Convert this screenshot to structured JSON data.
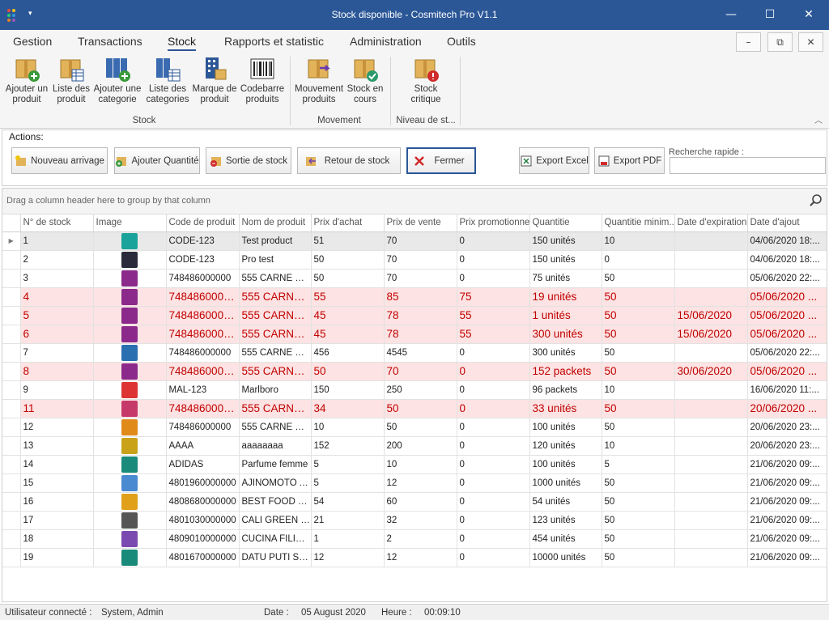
{
  "window": {
    "title": "Stock disponible - Cosmitech Pro V1.1",
    "qa_glyph": "▾",
    "minimize": "—",
    "maximize": "☐",
    "close": "✕"
  },
  "menu": {
    "items": [
      "Gestion",
      "Transactions",
      "Stock",
      "Rapports et statistic",
      "Administration",
      "Outils"
    ],
    "active": "Stock"
  },
  "mdi": {
    "minimize": "–",
    "restore": "⧉",
    "close": "✕"
  },
  "ribbon": {
    "buttons": [
      {
        "l1": "Ajouter un",
        "l2": "produit",
        "icon": "box-add-icon"
      },
      {
        "l1": "Liste des",
        "l2": "produit",
        "icon": "box-list-icon"
      },
      {
        "l1": "Ajouter une",
        "l2": "categorie",
        "icon": "binder-add-icon"
      },
      {
        "l1": "Liste des",
        "l2": "categories",
        "icon": "binder-list-icon"
      },
      {
        "l1": "Marque de",
        "l2": "produit",
        "icon": "building-icon"
      },
      {
        "l1": "Codebarre",
        "l2": "produits",
        "icon": "barcode-icon"
      },
      {
        "l1": "Mouvement",
        "l2": "produits",
        "icon": "box-move-icon"
      },
      {
        "l1": "Stock en",
        "l2": "cours",
        "icon": "box-check-icon"
      },
      {
        "l1": "Stock",
        "l2": "critique",
        "icon": "box-alert-icon"
      }
    ],
    "groups": [
      "Stock",
      "Movement",
      "Niveau de st..."
    ],
    "collapse_glyph": "︿"
  },
  "actions": {
    "label": "Actions:",
    "buttons": [
      "Nouveau arrivage",
      "Ajouter Quantité",
      "Sortie de stock",
      "Retour de stock",
      "Fermer",
      "Export Excel",
      "Export PDF"
    ],
    "search_label": "Recherche rapide :",
    "search_value": ""
  },
  "grid": {
    "group_hint": "Drag a column header here to group by that column",
    "columns": [
      "N° de stock",
      "Image",
      "Code de produit",
      "Nom de produit",
      "Prix d'achat",
      "Prix de vente",
      "Prix promotionnel",
      "Quantitie",
      "Quantitie minim...",
      "Date d'expiration",
      "Date d'ajout"
    ],
    "rows": [
      {
        "c": [
          "1",
          "",
          "CODE-123",
          "Test product",
          "51",
          "70",
          "0",
          "150 unités",
          "10",
          "",
          "04/06/2020 18:..."
        ],
        "crit": false,
        "thumb": "#1aa39a"
      },
      {
        "c": [
          "2",
          "",
          "CODE-123",
          "Pro test",
          "50",
          "70",
          "0",
          "150 unités",
          "0",
          "",
          "04/06/2020 18:..."
        ],
        "crit": false,
        "thumb": "#2a2a3a"
      },
      {
        "c": [
          "3",
          "",
          "748486000000",
          "555 CARNE NO...",
          "50",
          "70",
          "0",
          "75 unités",
          "50",
          "",
          "05/06/2020 22:..."
        ],
        "crit": false,
        "thumb": "#8b2a8b"
      },
      {
        "c": [
          "4",
          "",
          "7484860000...",
          "555 CARNE ...",
          "55",
          "85",
          "75",
          "19 unités",
          "50",
          "",
          "05/06/2020 ..."
        ],
        "crit": true,
        "thumb": "#8b2a8b"
      },
      {
        "c": [
          "5",
          "",
          "7484860000...",
          "555 CARNE ...",
          "45",
          "78",
          "55",
          "1 unités",
          "50",
          "15/06/2020",
          "05/06/2020 ..."
        ],
        "crit": true,
        "thumb": "#8b2a8b"
      },
      {
        "c": [
          "6",
          "",
          "7484860000...",
          "555 CARNE ...",
          "45",
          "78",
          "55",
          "300 unités",
          "50",
          "15/06/2020",
          "05/06/2020 ..."
        ],
        "crit": true,
        "thumb": "#8b2a8b"
      },
      {
        "c": [
          "7",
          "",
          "748486000000",
          "555 CARNE NO...",
          "456",
          "4545",
          "0",
          "300 unités",
          "50",
          "",
          "05/06/2020 22:..."
        ],
        "crit": false,
        "thumb": "#2a6fb0"
      },
      {
        "c": [
          "8",
          "",
          "7484860000...",
          "555 CARNE ...",
          "50",
          "70",
          "0",
          "152 packets",
          "50",
          "30/06/2020",
          "05/06/2020 ..."
        ],
        "crit": true,
        "thumb": "#8b2a8b"
      },
      {
        "c": [
          "9",
          "",
          "MAL-123",
          "Marlboro",
          "150",
          "250",
          "0",
          "96 packets",
          "10",
          "",
          "16/06/2020 11:..."
        ],
        "crit": false,
        "thumb": "#d33"
      },
      {
        "c": [
          "11",
          "",
          "7484860000...",
          "555 CARNE ...",
          "34",
          "50",
          "0",
          "33 unités",
          "50",
          "",
          "20/06/2020 ..."
        ],
        "crit": true,
        "thumb": "#c63a6a"
      },
      {
        "c": [
          "12",
          "",
          "748486000000",
          "555 CARNE NO...",
          "10",
          "50",
          "0",
          "100 unités",
          "50",
          "",
          "20/06/2020 23:..."
        ],
        "crit": false,
        "thumb": "#e08a1a"
      },
      {
        "c": [
          "13",
          "",
          "AAAA",
          "aaaaaaaa",
          "152",
          "200",
          "0",
          "120 unités",
          "10",
          "",
          "20/06/2020 23:..."
        ],
        "crit": false,
        "thumb": "#c9a21a"
      },
      {
        "c": [
          "14",
          "",
          "ADIDAS",
          "Parfume femme",
          "5",
          "10",
          "0",
          "100 unités",
          "5",
          "",
          "21/06/2020 09:..."
        ],
        "crit": false,
        "thumb": "#1a8a7a"
      },
      {
        "c": [
          "15",
          "",
          "4801960000000",
          "AJINOMOTO A...",
          "5",
          "12",
          "0",
          "1000 unités",
          "50",
          "",
          "21/06/2020 09:..."
        ],
        "crit": false,
        "thumb": "#4a8ad0"
      },
      {
        "c": [
          "16",
          "",
          "4808680000000",
          "BEST FOOD M...",
          "54",
          "60",
          "0",
          "54 unités",
          "50",
          "",
          "21/06/2020 09:..."
        ],
        "crit": false,
        "thumb": "#e0a01a"
      },
      {
        "c": [
          "17",
          "",
          "4801030000000",
          "CALI GREEN PI...",
          "21",
          "32",
          "0",
          "123 unités",
          "50",
          "",
          "21/06/2020 09:..."
        ],
        "crit": false,
        "thumb": "#555"
      },
      {
        "c": [
          "18",
          "",
          "4809010000000",
          "CUCINA FILIPI...",
          "1",
          "2",
          "0",
          "454 unités",
          "50",
          "",
          "21/06/2020 09:..."
        ],
        "crit": false,
        "thumb": "#7a4ab0"
      },
      {
        "c": [
          "19",
          "",
          "4801670000000",
          "DATU PUTI SO...",
          "12",
          "12",
          "0",
          "10000 unités",
          "50",
          "",
          "21/06/2020 09:..."
        ],
        "crit": false,
        "thumb": "#1a8a7a"
      }
    ]
  },
  "status": {
    "user_label": "Utilisateur connecté :",
    "user": "System, Admin",
    "date_label": "Date :",
    "date": "05 August 2020",
    "time_label": "Heure :",
    "time": "00:09:10"
  },
  "colors": {
    "titlebar": "#2b5797",
    "critical_bg": "#fde3e3",
    "critical_text": "#c00000"
  }
}
